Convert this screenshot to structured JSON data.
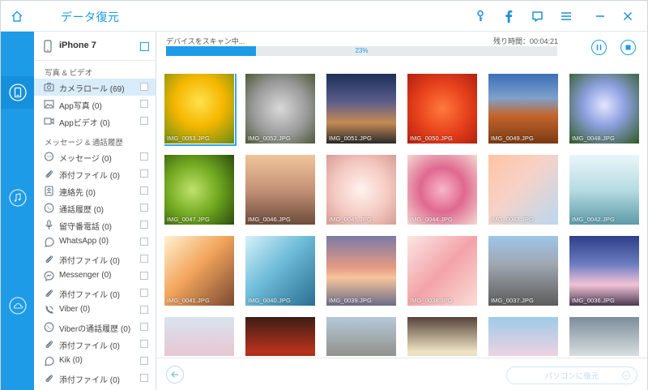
{
  "app": {
    "title": "データ復元"
  },
  "device": {
    "name": "iPhone 7"
  },
  "sidebar": {
    "group1": "写真 & ビデオ",
    "group2": "メッセージ & 通話履歴",
    "items": [
      {
        "label": "カメラロール (69)",
        "icon": "camera-roll-icon"
      },
      {
        "label": "App写真 (0)",
        "icon": "photo-icon"
      },
      {
        "label": "Appビデオ (0)",
        "icon": "video-icon"
      },
      {
        "label": "メッセージ (0)",
        "icon": "message-icon"
      },
      {
        "label": "添付ファイル (0)",
        "icon": "paperclip-icon"
      },
      {
        "label": "連絡先 (0)",
        "icon": "contact-icon"
      },
      {
        "label": "通話履歴 (0)",
        "icon": "phone-icon"
      },
      {
        "label": "留守番電話 (0)",
        "icon": "voicemail-icon"
      },
      {
        "label": "WhatsApp (0)",
        "icon": "whatsapp-icon"
      },
      {
        "label": "添付ファイル (0)",
        "icon": "paperclip-icon"
      },
      {
        "label": "Messenger (0)",
        "icon": "messenger-icon"
      },
      {
        "label": "添付ファイル (0)",
        "icon": "paperclip-icon"
      },
      {
        "label": "Viber (0)",
        "icon": "viber-icon"
      },
      {
        "label": "Viberの通話履歴 (0)",
        "icon": "viber-call-icon"
      },
      {
        "label": "添付ファイル (0)",
        "icon": "paperclip-icon"
      },
      {
        "label": "Kik (0)",
        "icon": "kik-icon"
      },
      {
        "label": "添付ファイル (0)",
        "icon": "paperclip-icon"
      }
    ]
  },
  "scan": {
    "status": "デバイスをスキャン中...",
    "remaining": "残り時間：00:04:21",
    "percent_label": "23%",
    "progress": 0.23
  },
  "photos": [
    {
      "name": "IMG_0053.JPG"
    },
    {
      "name": "IMG_0052.JPG"
    },
    {
      "name": "IMG_0051.JPG"
    },
    {
      "name": "IMG_0050.JPG"
    },
    {
      "name": "IMG_0049.JPG"
    },
    {
      "name": "IMG_0048.JPG"
    },
    {
      "name": "IMG_0047.JPG"
    },
    {
      "name": "IMG_0046.JPG"
    },
    {
      "name": "IMG_0045.JPG"
    },
    {
      "name": "IMG_0044.JPG"
    },
    {
      "name": "IMG_0043.JPG"
    },
    {
      "name": "IMG_0042.JPG"
    },
    {
      "name": "IMG_0041.JPG"
    },
    {
      "name": "IMG_0040.JPG"
    },
    {
      "name": "IMG_0039.JPG"
    },
    {
      "name": "IMG_0038.JPG"
    },
    {
      "name": "IMG_0037.JPG"
    },
    {
      "name": "IMG_0036.JPG"
    },
    {
      "name": ""
    },
    {
      "name": ""
    },
    {
      "name": ""
    },
    {
      "name": ""
    },
    {
      "name": ""
    },
    {
      "name": ""
    }
  ],
  "bottom": {
    "recover_label": "パソコンに復元"
  },
  "colors": {
    "accent": "#1e9be6",
    "rail": "#1e9be6"
  }
}
